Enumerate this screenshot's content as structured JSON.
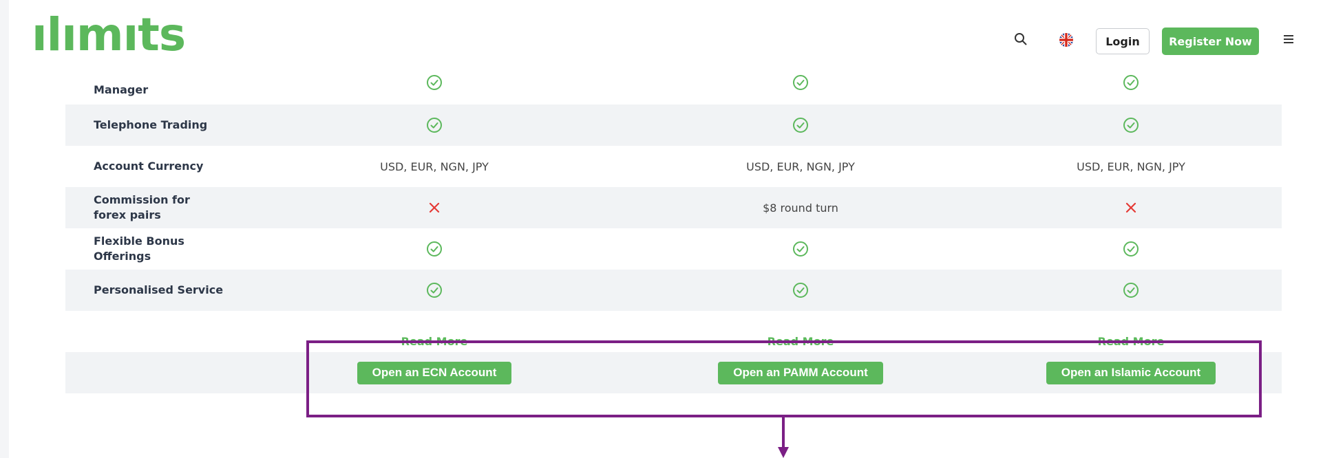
{
  "header": {
    "logo_text": "ılımıts",
    "login_label": "Login",
    "register_label": "Register Now",
    "icons": [
      "search-icon",
      "uk-flag-icon",
      "hamburger-menu-icon"
    ]
  },
  "table": {
    "rows": [
      {
        "label": "Manager",
        "ecn": "check",
        "pamm": "check",
        "islamic": "check"
      },
      {
        "label": "Telephone Trading",
        "ecn": "check",
        "pamm": "check",
        "islamic": "check"
      },
      {
        "label": "Account Currency",
        "ecn": "USD, EUR, NGN, JPY",
        "pamm": "USD, EUR, NGN, JPY",
        "islamic": "USD, EUR, NGN, JPY"
      },
      {
        "label": "Commission for forex pairs",
        "ecn": "cross",
        "pamm": "$8 round turn",
        "islamic": "cross"
      },
      {
        "label": "Flexible Bonus Offerings",
        "ecn": "check",
        "pamm": "check",
        "islamic": "check"
      },
      {
        "label": "Personalised Service",
        "ecn": "check",
        "pamm": "check",
        "islamic": "check"
      }
    ],
    "read_more": {
      "ecn": "Read More",
      "pamm": "Read More",
      "islamic": "Read More"
    },
    "open_buttons": {
      "ecn": "Open an ECN Account",
      "pamm": "Open an PAMM Account",
      "islamic": "Open an Islamic Account"
    }
  },
  "colors": {
    "brand_green": "#5cb85c",
    "row_shade": "#f1f3f5",
    "cross_red": "#e53935",
    "highlight_purple": "#7b1f85"
  }
}
